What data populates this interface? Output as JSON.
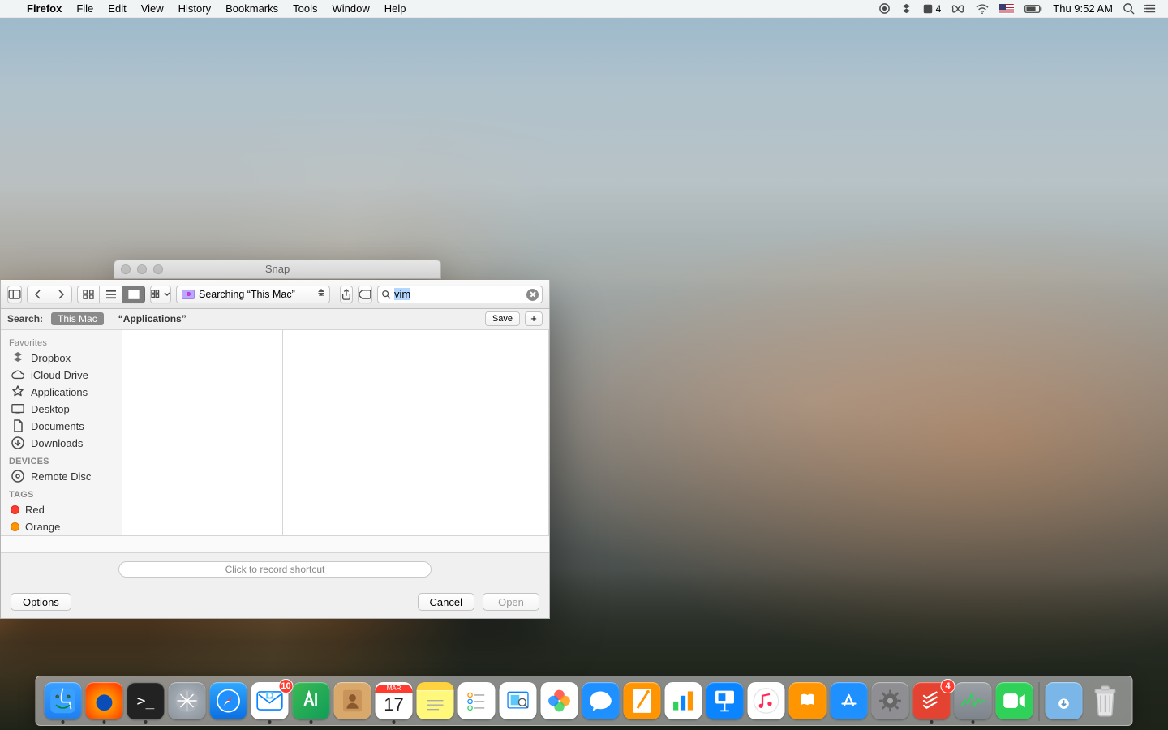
{
  "menubar": {
    "app": "Firefox",
    "items": [
      "File",
      "Edit",
      "View",
      "History",
      "Bookmarks",
      "Tools",
      "Window",
      "Help"
    ],
    "right": {
      "dropbox_badge": "4",
      "clock": "Thu 9:52 AM"
    }
  },
  "snap_window": {
    "title": "Snap"
  },
  "sheet": {
    "path_label": "Searching “This Mac”",
    "search_value": "vim",
    "scope": {
      "label": "Search:",
      "this_mac": "This Mac",
      "applications": "“Applications”",
      "save": "Save",
      "plus": "+"
    },
    "sidebar": {
      "favorites_header": "Favorites",
      "favorites": [
        "Dropbox",
        "iCloud Drive",
        "Applications",
        "Desktop",
        "Documents",
        "Downloads"
      ],
      "devices_header": "Devices",
      "devices": [
        "Remote Disc"
      ],
      "tags_header": "Tags",
      "tags": [
        "Red",
        "Orange"
      ]
    },
    "shortcut_placeholder": "Click to record shortcut",
    "buttons": {
      "options": "Options",
      "cancel": "Cancel",
      "open": "Open"
    }
  },
  "dock": {
    "items": [
      {
        "name": "finder",
        "running": true
      },
      {
        "name": "firefox",
        "running": true
      },
      {
        "name": "terminal",
        "running": true
      },
      {
        "name": "launchpad",
        "running": false
      },
      {
        "name": "safari",
        "running": false
      },
      {
        "name": "mail",
        "running": true,
        "badge": "10"
      },
      {
        "name": "editor",
        "running": true
      },
      {
        "name": "contacts",
        "running": false
      },
      {
        "name": "calendar",
        "running": true,
        "month": "MAR",
        "day": "17"
      },
      {
        "name": "notes",
        "running": false
      },
      {
        "name": "reminders",
        "running": false
      },
      {
        "name": "keynote-viewer",
        "running": false
      },
      {
        "name": "photos",
        "running": false
      },
      {
        "name": "messages",
        "running": false
      },
      {
        "name": "pages",
        "running": false
      },
      {
        "name": "numbers",
        "running": false
      },
      {
        "name": "keynote",
        "running": false
      },
      {
        "name": "itunes",
        "running": false
      },
      {
        "name": "ibooks",
        "running": false
      },
      {
        "name": "appstore",
        "running": false
      },
      {
        "name": "system-preferences",
        "running": false
      },
      {
        "name": "todoist",
        "running": true,
        "badge": "4"
      },
      {
        "name": "activity",
        "running": true
      },
      {
        "name": "facetime",
        "running": false
      }
    ]
  }
}
